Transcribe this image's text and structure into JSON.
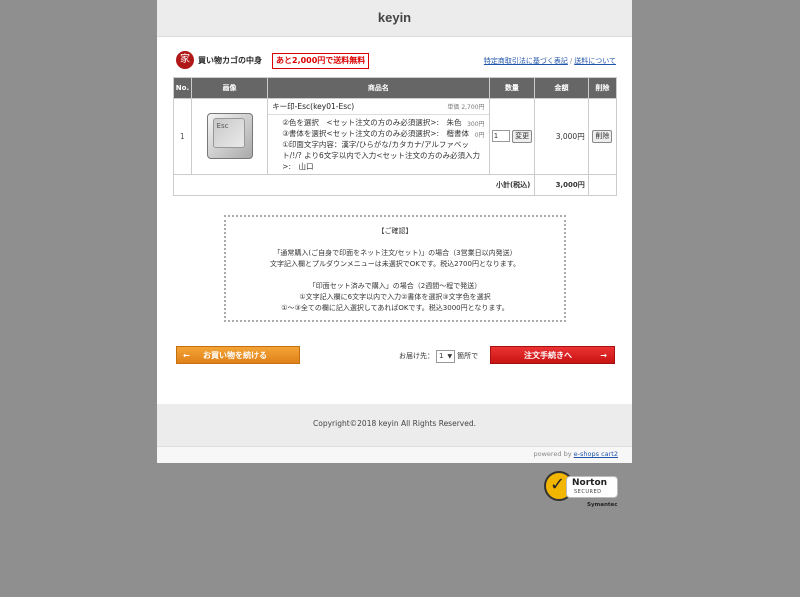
{
  "header": {
    "title": "keyin"
  },
  "cart_header": {
    "logo_char": "家",
    "title": "買い物カゴの中身",
    "free_shipping_badge": "あと2,000円で送料無料",
    "link_tokutei": "特定商取引法に基づく表記",
    "link_shipping": "送料について",
    "separator": "/"
  },
  "table": {
    "columns": {
      "no": "No.",
      "image": "画像",
      "product": "商品名",
      "qty": "数量",
      "amount": "金額",
      "delete": "削除"
    },
    "row": {
      "no": "1",
      "keycap_label": "Esc",
      "product_name": "キー印-Esc(key01-Esc)",
      "unit_price": "単価 2,700円",
      "option1": "②色を選択　<セット注文の方のみ必須選択>:　朱色",
      "option1_price": "300円",
      "option2": "③書体を選択<セット注文の方のみ必須選択>:　楷書体",
      "option2_price": "0円",
      "option3": "①印面文字内容：漢字/ひらがな/カタカナ/アルファベット/!/? より6文字以内で入力<セット注文の方のみ必須入力>:　山口",
      "qty": "1",
      "change_button": "変更",
      "amount": "3,000円",
      "delete_button": "削除"
    },
    "subtotal_label": "小計(税込)",
    "subtotal_value": "3,000円"
  },
  "notice": {
    "title": "【ご確認】",
    "line1": "「通常購入(ご自身で印面をネット注文/セット)」の場合（3営業日以内発送）",
    "line2": "文字記入欄とプルダウンメニューは未選択でOKです。税込2700円となります。",
    "line3": "「印面セット済みで購入」の場合（2週間～程で発送）",
    "line4": "①文字記入欄に6文字以内で入力②書体を選択③文字色を選択",
    "line5": "①～③全ての欄に記入選択してあればOKです。税込3000円となります。"
  },
  "actions": {
    "continue_arrow": "←",
    "continue_label": "お買い物を続ける",
    "destination_label": "お届け先：",
    "destination_value": "1",
    "destination_suffix": "箇所で",
    "order_label": "注文手続きへ",
    "order_arrow": "→"
  },
  "footer": {
    "copyright": "Copyright©2018 keyin All Rights Reserved.",
    "powered_by": "powered by",
    "powered_link": "e-shops cart2"
  },
  "norton": {
    "brand": "Norton",
    "secured": "SECURED",
    "vendor": "Symantec"
  },
  "colors": {
    "background": "#8f8f8f",
    "accent_orange": "#e8911f",
    "accent_red": "#d81e1e",
    "badge_red": "#dd0000"
  }
}
